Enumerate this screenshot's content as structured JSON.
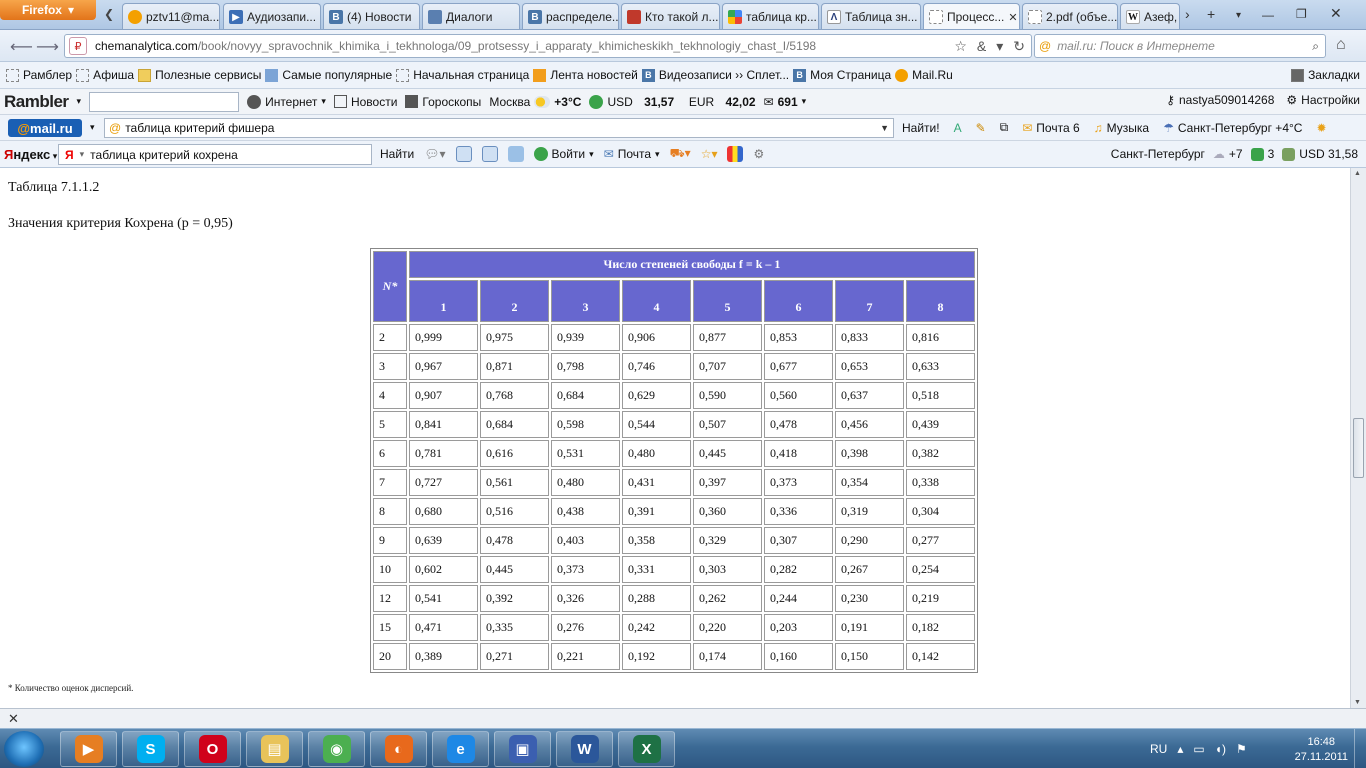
{
  "browser": {
    "menu_label": "Firefox",
    "tabs": [
      {
        "label": "pztv11@ma...",
        "icon": "mail"
      },
      {
        "label": "Аудиозапи...",
        "icon": "play"
      },
      {
        "label": "(4) Новости",
        "icon": "vk"
      },
      {
        "label": "Диалоги",
        "icon": "msg"
      },
      {
        "label": "распределе...",
        "icon": "vk"
      },
      {
        "label": "Кто такой л...",
        "icon": "red"
      },
      {
        "label": "таблица кр...",
        "icon": "g"
      },
      {
        "label": "Таблица зн...",
        "icon": "tri"
      },
      {
        "label": "Процесс...",
        "icon": "blank"
      },
      {
        "label": "2.pdf (объе...",
        "icon": "blank"
      },
      {
        "label": "Азеф,",
        "icon": "wiki"
      }
    ],
    "url": {
      "domain": "chemanalytica.com",
      "path": "/book/novyy_spravochnik_khimika_i_tekhnologa/09_protsessy_i_apparaty_khimicheskikh_tekhnologiy_chast_I/5198"
    },
    "search_placeholder": "mail.ru: Поиск в Интернете"
  },
  "bookmarks": {
    "items": [
      {
        "label": "Рамблер",
        "icon": "blank"
      },
      {
        "label": "Афиша",
        "icon": "blank"
      },
      {
        "label": "Полезные сервисы",
        "icon": "folder"
      },
      {
        "label": "Самые популярные",
        "icon": "blue"
      },
      {
        "label": "Начальная страница",
        "icon": "blank"
      },
      {
        "label": "Лента новостей",
        "icon": "rss"
      },
      {
        "label": "Видеозаписи ›› Сплет...",
        "icon": "vk"
      },
      {
        "label": "Моя Страница",
        "icon": "vk"
      },
      {
        "label": "Mail.Ru",
        "icon": "mail"
      }
    ],
    "right_label": "Закладки"
  },
  "rambler": {
    "logo": "Rambler",
    "internet": "Интернет",
    "news": "Новости",
    "horoscopes": "Гороскопы",
    "city": "Москва",
    "temp": "+3°C",
    "usd_label": "USD",
    "usd_value": "31,57",
    "eur_label": "EUR",
    "eur_value": "42,02",
    "mail_count": "691",
    "user": "nastya509014268",
    "settings": "Настройки"
  },
  "mailru": {
    "logo_at": "@",
    "logo_text": "mail.ru",
    "query": "таблица критерий фишера",
    "find": "Найти!",
    "mail": "Почта 6",
    "music": "Музыка",
    "weather": "Санкт-Петербург +4°C"
  },
  "yandex": {
    "logo_y": "Я",
    "logo_rest": "ндекс",
    "query": "таблица критерий кохрена",
    "find": "Найти",
    "login": "Войти",
    "mail": "Почта",
    "city": "Санкт-Петербург",
    "temp": "+7",
    "badge": "3",
    "usd": "USD 31,58"
  },
  "content": {
    "caption": "Таблица 7.1.1.2",
    "subcaption": "Значения критерия Кохрена (p = 0,95)",
    "table": {
      "n_header": "N*",
      "f_header": "Число степеней свободы f = k – 1",
      "columns": [
        "1",
        "2",
        "3",
        "4",
        "5",
        "6",
        "7",
        "8"
      ],
      "rows": [
        {
          "n": "2",
          "v": [
            "0,999",
            "0,975",
            "0,939",
            "0,906",
            "0,877",
            "0,853",
            "0,833",
            "0,816"
          ]
        },
        {
          "n": "3",
          "v": [
            "0,967",
            "0,871",
            "0,798",
            "0,746",
            "0,707",
            "0,677",
            "0,653",
            "0,633"
          ]
        },
        {
          "n": "4",
          "v": [
            "0,907",
            "0,768",
            "0,684",
            "0,629",
            "0,590",
            "0,560",
            "0,637",
            "0,518"
          ]
        },
        {
          "n": "5",
          "v": [
            "0,841",
            "0,684",
            "0,598",
            "0,544",
            "0,507",
            "0,478",
            "0,456",
            "0,439"
          ]
        },
        {
          "n": "6",
          "v": [
            "0,781",
            "0,616",
            "0,531",
            "0,480",
            "0,445",
            "0,418",
            "0,398",
            "0,382"
          ]
        },
        {
          "n": "7",
          "v": [
            "0,727",
            "0,561",
            "0,480",
            "0,431",
            "0,397",
            "0,373",
            "0,354",
            "0,338"
          ]
        },
        {
          "n": "8",
          "v": [
            "0,680",
            "0,516",
            "0,438",
            "0,391",
            "0,360",
            "0,336",
            "0,319",
            "0,304"
          ]
        },
        {
          "n": "9",
          "v": [
            "0,639",
            "0,478",
            "0,403",
            "0,358",
            "0,329",
            "0,307",
            "0,290",
            "0,277"
          ]
        },
        {
          "n": "10",
          "v": [
            "0,602",
            "0,445",
            "0,373",
            "0,331",
            "0,303",
            "0,282",
            "0,267",
            "0,254"
          ]
        },
        {
          "n": "12",
          "v": [
            "0,541",
            "0,392",
            "0,326",
            "0,288",
            "0,262",
            "0,244",
            "0,230",
            "0,219"
          ]
        },
        {
          "n": "15",
          "v": [
            "0,471",
            "0,335",
            "0,276",
            "0,242",
            "0,220",
            "0,203",
            "0,191",
            "0,182"
          ]
        },
        {
          "n": "20",
          "v": [
            "0,389",
            "0,271",
            "0,221",
            "0,192",
            "0,174",
            "0,160",
            "0,150",
            "0,142"
          ]
        }
      ]
    },
    "footnote": "* Количество оценок дисперсий."
  },
  "taskbar": {
    "apps": [
      {
        "name": "media-player-icon",
        "color": "#e67e22",
        "glyph": "▶"
      },
      {
        "name": "skype-icon",
        "color": "#00aff0",
        "glyph": "S"
      },
      {
        "name": "opera-icon",
        "color": "#d0021b",
        "glyph": "O"
      },
      {
        "name": "explorer-icon",
        "color": "#e8c35a",
        "glyph": "▤"
      },
      {
        "name": "chrome-icon",
        "color": "#4caf50",
        "glyph": "◉"
      },
      {
        "name": "firefox-icon",
        "color": "#e8691c",
        "glyph": "◐"
      },
      {
        "name": "ie-icon",
        "color": "#1e88e5",
        "glyph": "e"
      },
      {
        "name": "save-icon",
        "color": "#3b5fb0",
        "glyph": "▣"
      },
      {
        "name": "word-icon",
        "color": "#2b579a",
        "glyph": "W"
      },
      {
        "name": "excel-icon",
        "color": "#1e7145",
        "glyph": "X"
      }
    ],
    "lang": "RU",
    "time": "16:48",
    "date": "27.11.2011"
  }
}
